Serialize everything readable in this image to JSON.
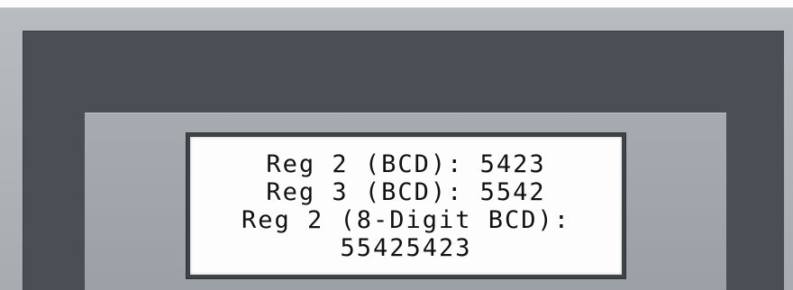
{
  "display": {
    "lines": [
      "Reg 2 (BCD): 5423",
      "Reg 3 (BCD): 5542",
      "Reg 2 (8-Digit BCD):",
      "55425423"
    ]
  }
}
